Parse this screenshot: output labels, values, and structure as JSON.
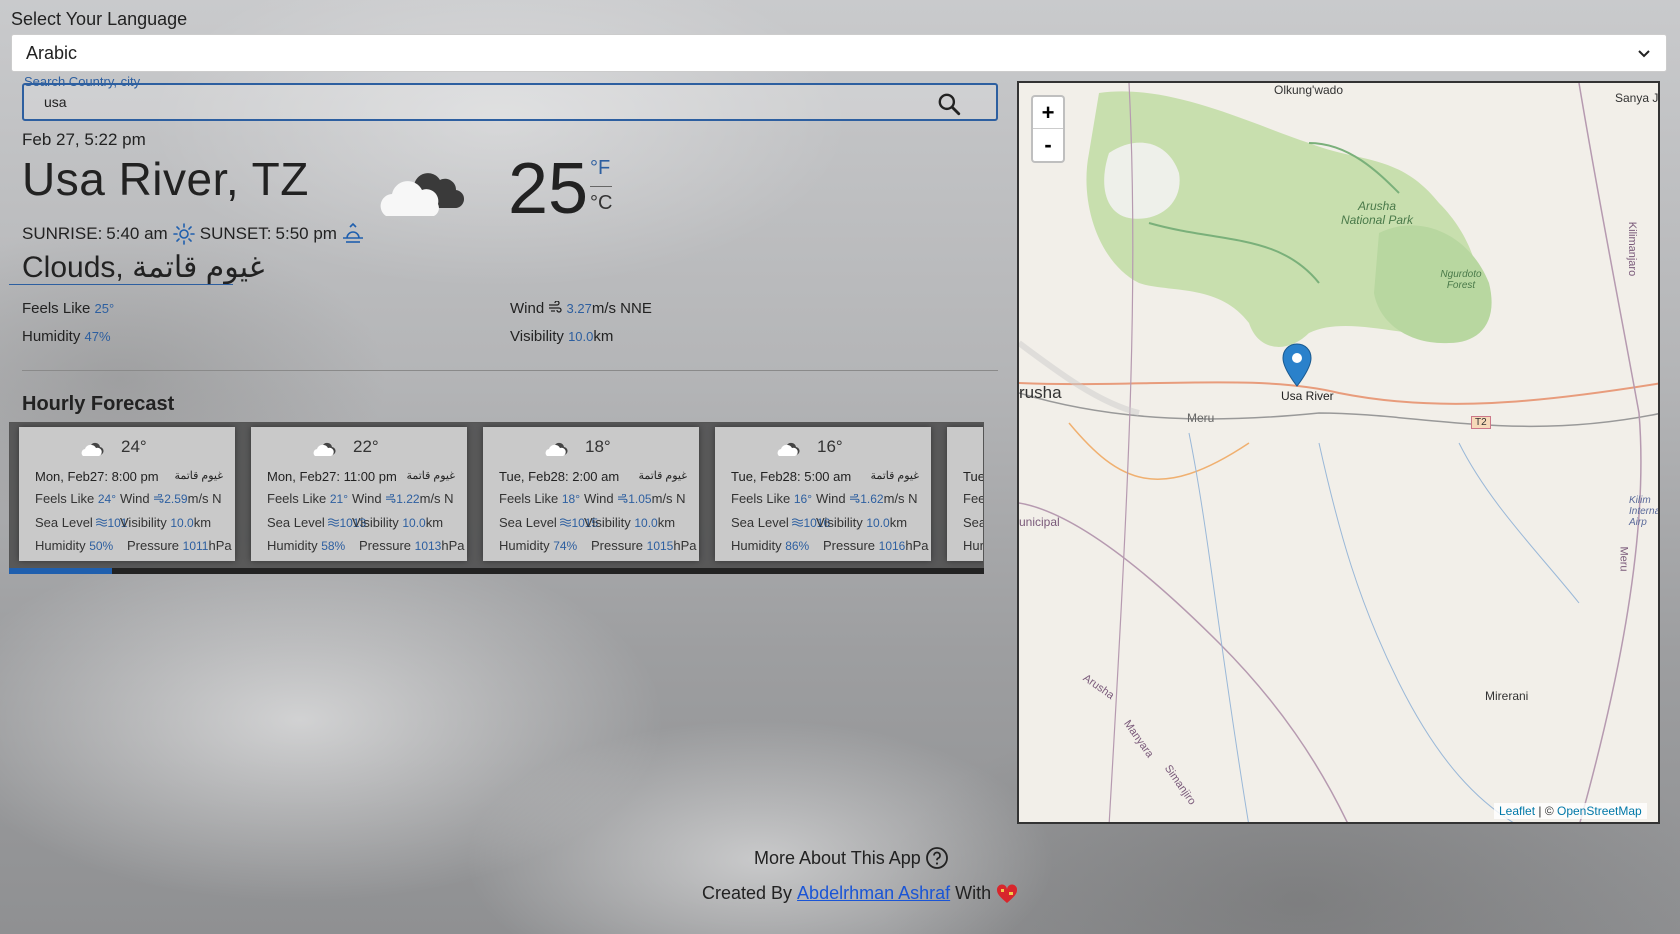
{
  "language": {
    "label": "Select Your Language",
    "selected": "Arabic"
  },
  "search": {
    "legend": "Search Country, city",
    "value": "usa"
  },
  "current": {
    "date": "Feb 27, 5:22 pm",
    "city": "Usa River, TZ",
    "temperature": "25",
    "unit_f": "°F",
    "unit_c": "°C",
    "sunrise_label": "SUNRISE:",
    "sunrise": "5:40 am",
    "sunset_label": "SUNSET:",
    "sunset": "5:50 pm",
    "condition": "Clouds, غيوم قاتمة",
    "feels_label": "Feels Like",
    "feels": "25°",
    "humidity_label": "Humidity",
    "humidity": "47",
    "humidity_unit": "%",
    "wind_label": "Wind",
    "wind": "3.27",
    "wind_unit": "m/s NNE",
    "visibility_label": "Visibility",
    "visibility": "10.0",
    "visibility_unit": "km"
  },
  "hourly": {
    "title": "Hourly Forecast",
    "cards": [
      {
        "temp": "24°",
        "time": "Mon, Feb27: 8:00 pm",
        "desc": "غيوم قاتمة",
        "feels": "24°",
        "wind": "2.59",
        "wind_dir": "m/s N",
        "sea": "101",
        "vis": "10.0",
        "humidity": "50%",
        "pressure": "1011"
      },
      {
        "temp": "22°",
        "time": "Mon, Feb27: 11:00 pm",
        "desc": "غيوم قاتمة",
        "feels": "21°",
        "wind": "1.22",
        "wind_dir": "m/s N",
        "sea": "1013",
        "vis": "10.0",
        "humidity": "58%",
        "pressure": "1013"
      },
      {
        "temp": "18°",
        "time": "Tue, Feb28: 2:00 am",
        "desc": "غيوم قاتمة",
        "feels": "18°",
        "wind": "1.05",
        "wind_dir": "m/s N",
        "sea": "1015",
        "vis": "10.0",
        "humidity": "74%",
        "pressure": "1015"
      },
      {
        "temp": "16°",
        "time": "Tue, Feb28: 5:00 am",
        "desc": "غيوم قاتمة",
        "feels": "16°",
        "wind": "1.62",
        "wind_dir": "m/s N",
        "sea": "1016",
        "vis": "10.0",
        "humidity": "86%",
        "pressure": "1016"
      }
    ],
    "partial_card": {
      "time": "Tue",
      "feels_label": "Fee",
      "sea_label": "Sea",
      "hum_label": "Hur"
    },
    "labels": {
      "feels": "Feels Like",
      "wind": "Wind",
      "sea": "Sea Level",
      "vis": "Visibility",
      "vis_unit": "km",
      "humidity": "Humidity",
      "pressure": "Pressure",
      "pressure_unit": "hPa"
    },
    "scroll_position": 0.1
  },
  "map": {
    "zoom_in": "+",
    "zoom_out": "-",
    "marker_label": "Usa River",
    "labels": [
      "Olkung'wado",
      "Sanya J",
      "Arusha National Park",
      "Ngurdoto Forest",
      "rusha",
      "Meru",
      "T2",
      "unicipal",
      "Arusha",
      "Manyara",
      "Simanjiro",
      "Mirerani",
      "Kilimanjaro",
      "Kilim Interna Airp",
      "Meru"
    ],
    "attribution": {
      "leaflet": "Leaflet",
      "sep": " | © ",
      "osm": "OpenStreetMap"
    }
  },
  "footer": {
    "more": "More About This App",
    "created_by": "Created By",
    "author": "Abdelrhman Ashraf",
    "with": "With"
  }
}
